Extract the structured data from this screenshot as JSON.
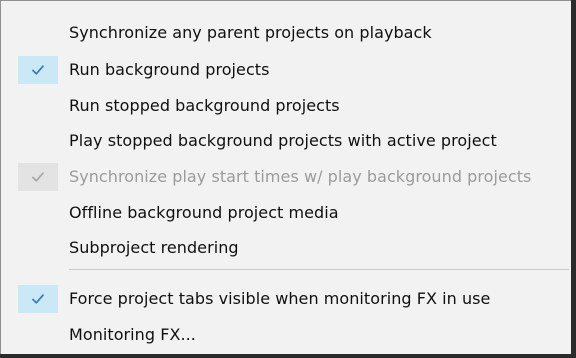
{
  "menu": {
    "items": [
      {
        "label": "Synchronize any parent projects on playback",
        "checked": false,
        "disabled": false
      },
      {
        "label": "Run background projects",
        "checked": true,
        "disabled": false
      },
      {
        "label": "Run stopped background projects",
        "checked": false,
        "disabled": false
      },
      {
        "label": "Play stopped background projects with active project",
        "checked": false,
        "disabled": false
      },
      {
        "label": "Synchronize play start times w/ play background projects",
        "checked": true,
        "disabled": true
      },
      {
        "label": "Offline background project media",
        "checked": false,
        "disabled": false
      },
      {
        "label": "Subproject rendering",
        "checked": false,
        "disabled": false
      },
      {
        "label": "Force project tabs visible when monitoring FX in use",
        "checked": true,
        "disabled": false
      },
      {
        "label": "Monitoring FX...",
        "checked": false,
        "disabled": false
      }
    ]
  },
  "colors": {
    "menu_background": "#f2f2f2",
    "check_highlight": "#cbe8f6",
    "check_disabled": "#e3e3e3",
    "checkmark": "#3d7bbd",
    "checkmark_disabled": "#a8a8a8",
    "text": "#101010",
    "text_disabled": "#9b9b9b"
  },
  "icons": {
    "check": "checkmark-icon"
  }
}
